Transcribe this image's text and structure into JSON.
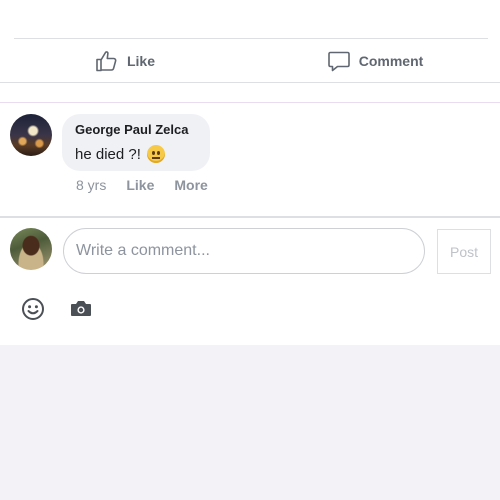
{
  "actions": {
    "like_label": "Like",
    "comment_label": "Comment"
  },
  "comment": {
    "author": "George Paul Zelca",
    "text": "he died ?!",
    "emoji": "neutral-face-icon",
    "age": "8 yrs",
    "like_label": "Like",
    "more_label": "More"
  },
  "composer": {
    "placeholder": "Write a comment...",
    "value": "",
    "post_label": "Post",
    "emoji_icon": "smiley-icon",
    "camera_icon": "camera-icon"
  },
  "colors": {
    "text_muted": "#606770",
    "meta": "#8d949e",
    "bubble_bg": "#f0f1f5",
    "icon": "#4b4f56"
  }
}
